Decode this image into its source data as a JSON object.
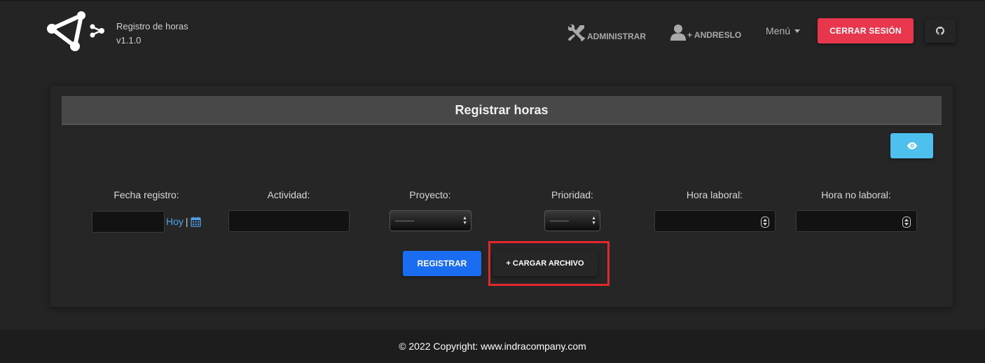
{
  "brand": {
    "title": "Registro de horas",
    "version": "v1.1.0",
    "logo_icon": "share-nodes-logo-icon"
  },
  "nav": {
    "admin_label": "ADMINISTRAR",
    "admin_icon": "tools-icon",
    "user_label": "+ ANDRESLO",
    "user_icon": "user-icon",
    "menu_label": "Menú",
    "logout_label": "CERRAR SESIÓN",
    "github_icon": "github-icon"
  },
  "card": {
    "title": "Registrar horas",
    "eye_icon": "eye-icon"
  },
  "form": {
    "labels": {
      "fecha": "Fecha registro:",
      "actividad": "Actividad:",
      "proyecto": "Proyecto:",
      "prioridad": "Prioridad:",
      "hora_laboral": "Hora laboral:",
      "hora_no_laboral": "Hora no laboral:"
    },
    "fecha_value": "",
    "actividad_value": "",
    "proyecto_selected": "---------",
    "prioridad_selected": "---------",
    "hora_laboral_value": "",
    "hora_no_laboral_value": "",
    "hoy_label": "Hoy",
    "separator": "|",
    "calendar_icon": "calendar-icon"
  },
  "actions": {
    "registrar_label": "REGISTRAR",
    "cargar_label": "+ CARGAR ARCHIVO"
  },
  "colors": {
    "logout": "#e8374d",
    "registrar": "#1a6cf0",
    "eye_button": "#4ec0ee",
    "link": "#4ea3e8",
    "highlight": "#e0282e"
  },
  "footer": {
    "text": "© 2022 Copyright: www.indracompany.com"
  }
}
